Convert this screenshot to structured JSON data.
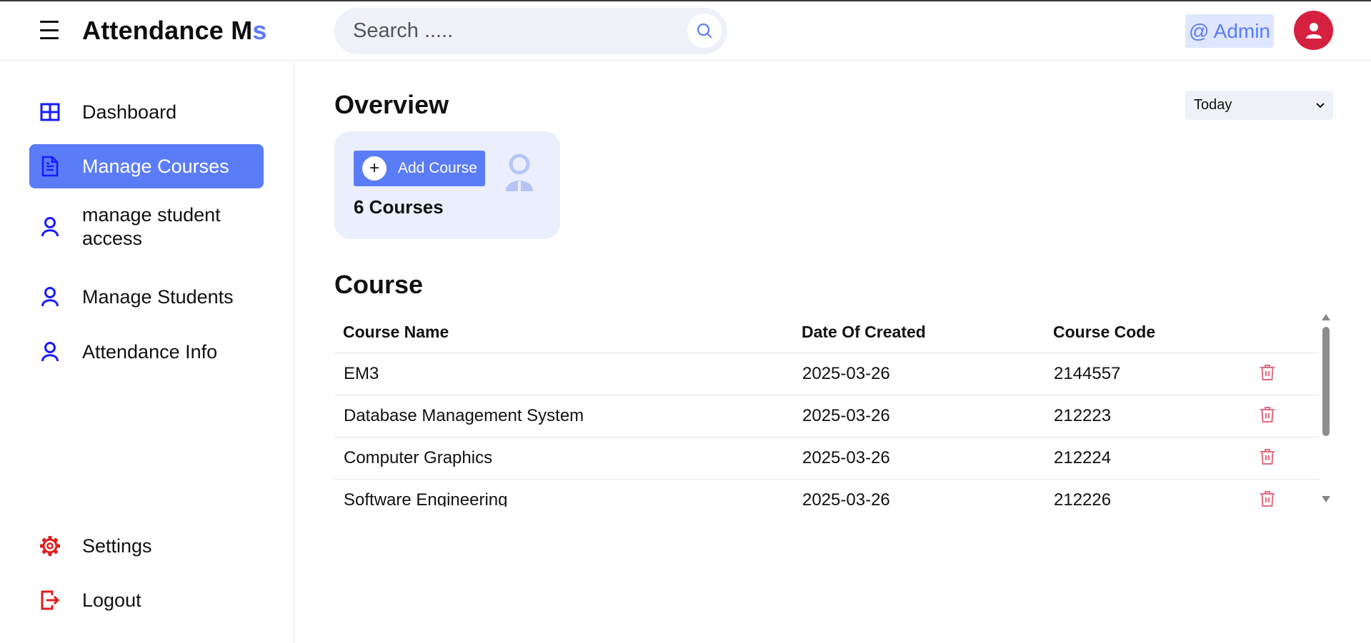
{
  "header": {
    "brand_main": "Attendance M",
    "brand_accent": "s",
    "search_placeholder": "Search .....",
    "admin_label": "@ Admin"
  },
  "sidebar": {
    "items": [
      {
        "label": "Dashboard",
        "icon": "grid-icon",
        "active": false
      },
      {
        "label": "Manage Courses",
        "icon": "document-icon",
        "active": true
      },
      {
        "label": "manage student access",
        "icon": "user-icon",
        "active": false
      },
      {
        "label": "Manage Students",
        "icon": "user-icon",
        "active": false
      },
      {
        "label": "Attendance Info",
        "icon": "user-icon",
        "active": false
      }
    ],
    "bottom": [
      {
        "label": "Settings",
        "icon": "gear-icon"
      },
      {
        "label": "Logout",
        "icon": "logout-icon"
      }
    ]
  },
  "overview": {
    "title": "Overview",
    "range_selected": "Today",
    "add_course_label": "Add Course",
    "course_count_label": "6 Courses"
  },
  "course": {
    "title": "Course",
    "columns": [
      "Course Name",
      "Date Of Created",
      "Course Code",
      ""
    ],
    "rows": [
      {
        "name": "EM3",
        "date": "2025-03-26",
        "code": "2144557"
      },
      {
        "name": "Database Management System",
        "date": "2025-03-26",
        "code": "212223"
      },
      {
        "name": "Computer Graphics",
        "date": "2025-03-26",
        "code": "212224"
      },
      {
        "name": "Software Engineering",
        "date": "2025-03-26",
        "code": "212226"
      }
    ]
  },
  "colors": {
    "accent": "#5b7cf7",
    "nav_icon": "#1a1aff",
    "danger": "#e01e1e",
    "delete_icon": "#e26a80",
    "avatar_bg": "#d6203f"
  }
}
